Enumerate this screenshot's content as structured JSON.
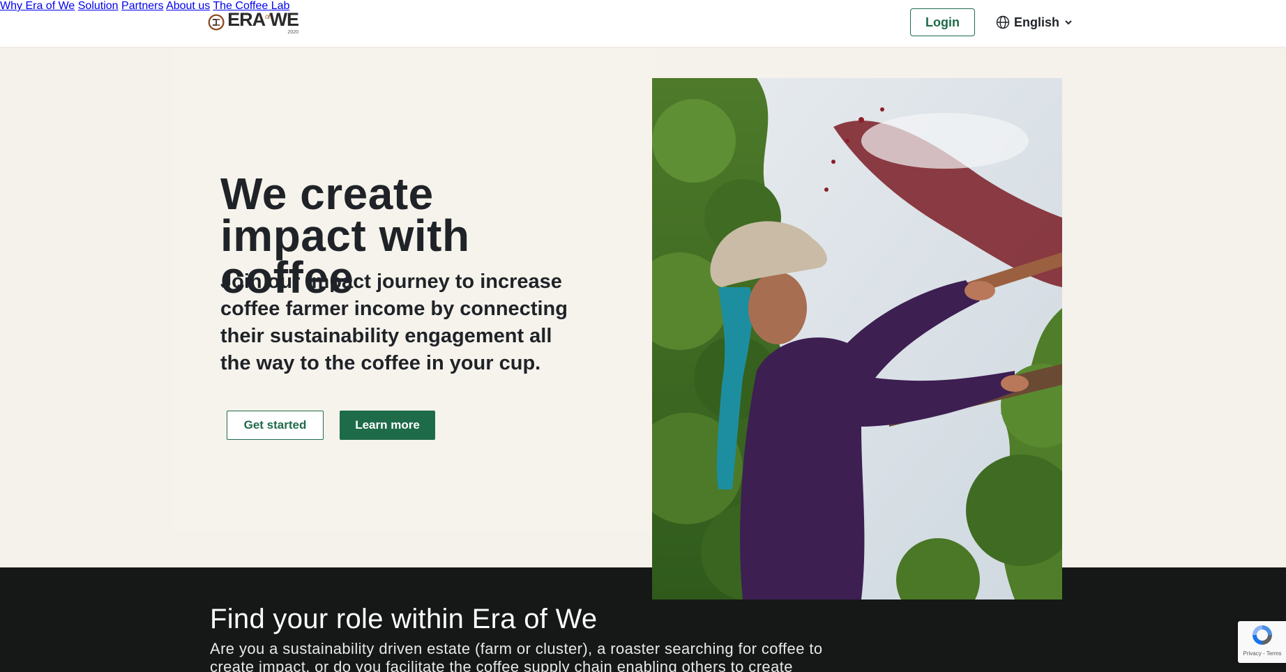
{
  "header": {
    "logo_text": "ERA",
    "logo_of": "of",
    "logo_we": "WE",
    "logo_year": "2020",
    "nav": [
      {
        "label": "Why Era of We"
      },
      {
        "label": "Solution"
      },
      {
        "label": "Partners"
      },
      {
        "label": "About us"
      },
      {
        "label": "The Coffee Lab"
      }
    ],
    "login_label": "Login",
    "language": "English"
  },
  "hero": {
    "title": "We create impact with coffee",
    "subtitle": "Join our impact journey to increase coffee farmer income by connecting their sustainability engagement all the way to the coffee in your cup.",
    "get_started_label": "Get started",
    "learn_more_label": "Learn more"
  },
  "role_section": {
    "title": "Find your role within Era of We",
    "text": "Are you a sustainability driven estate (farm or cluster), a roaster searching for coffee to create impact, or do you facilitate the coffee supply chain enabling others to create impact?"
  },
  "recaptcha": {
    "terms": "Privacy - Terms"
  },
  "colors": {
    "accent": "#1e6b4a",
    "hero_bg": "#f5f2eb",
    "dark_section": "#151816"
  },
  "icons": {
    "logo": "era-of-we-logo-icon",
    "language": "globe-icon",
    "dropdown": "chevron-down-icon",
    "recaptcha": "recaptcha-icon"
  }
}
